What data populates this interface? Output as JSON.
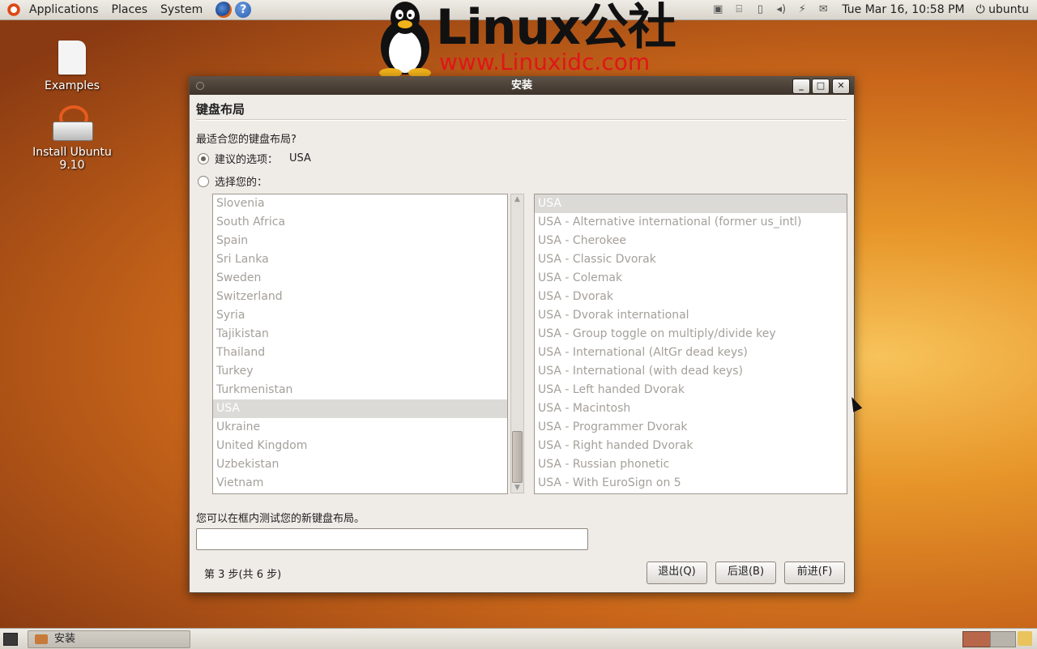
{
  "top_panel": {
    "menus": [
      "Applications",
      "Places",
      "System"
    ],
    "clock": "Tue Mar 16, 10:58 PM",
    "user": "ubuntu"
  },
  "desktop": {
    "icons": [
      {
        "label": "Examples"
      },
      {
        "label": "Install Ubuntu 9.10"
      }
    ]
  },
  "watermark": {
    "title": "Linux公社",
    "url": "www.Linuxidc.com"
  },
  "window": {
    "title": "安装",
    "heading": "键盘布局",
    "question": "最适合您的键盘布局?",
    "suggested_label": "建议的选项：",
    "suggested_value": "USA",
    "choose_label": "选择您的：",
    "countries": [
      "Slovenia",
      "South Africa",
      "Spain",
      "Sri Lanka",
      "Sweden",
      "Switzerland",
      "Syria",
      "Tajikistan",
      "Thailand",
      "Turkey",
      "Turkmenistan",
      "USA",
      "Ukraine",
      "United Kingdom",
      "Uzbekistan",
      "Vietnam"
    ],
    "selected_country": "USA",
    "variants": [
      "USA",
      "USA - Alternative international (former us_intl)",
      "USA - Cherokee",
      "USA - Classic Dvorak",
      "USA - Colemak",
      "USA - Dvorak",
      "USA - Dvorak international",
      "USA - Group toggle on multiply/divide key",
      "USA - International (AltGr dead keys)",
      "USA - International (with dead keys)",
      "USA - Left handed Dvorak",
      "USA - Macintosh",
      "USA - Programmer Dvorak",
      "USA - Right handed Dvorak",
      "USA - Russian phonetic",
      "USA - With EuroSign on 5"
    ],
    "selected_variant": "USA",
    "test_label": "您可以在框内测试您的新键盘布局。",
    "test_value": "",
    "step": "第 3 步(共 6 步)",
    "buttons": {
      "quit": "退出(Q)",
      "back": "后退(B)",
      "forward": "前进(F)"
    }
  },
  "bottom_panel": {
    "task": "安装"
  },
  "colors": {
    "panel": "#dcd8cf",
    "titlebar": "#4a4037",
    "wallpaper": "#d47f24",
    "list_text": "#a4a09b"
  }
}
